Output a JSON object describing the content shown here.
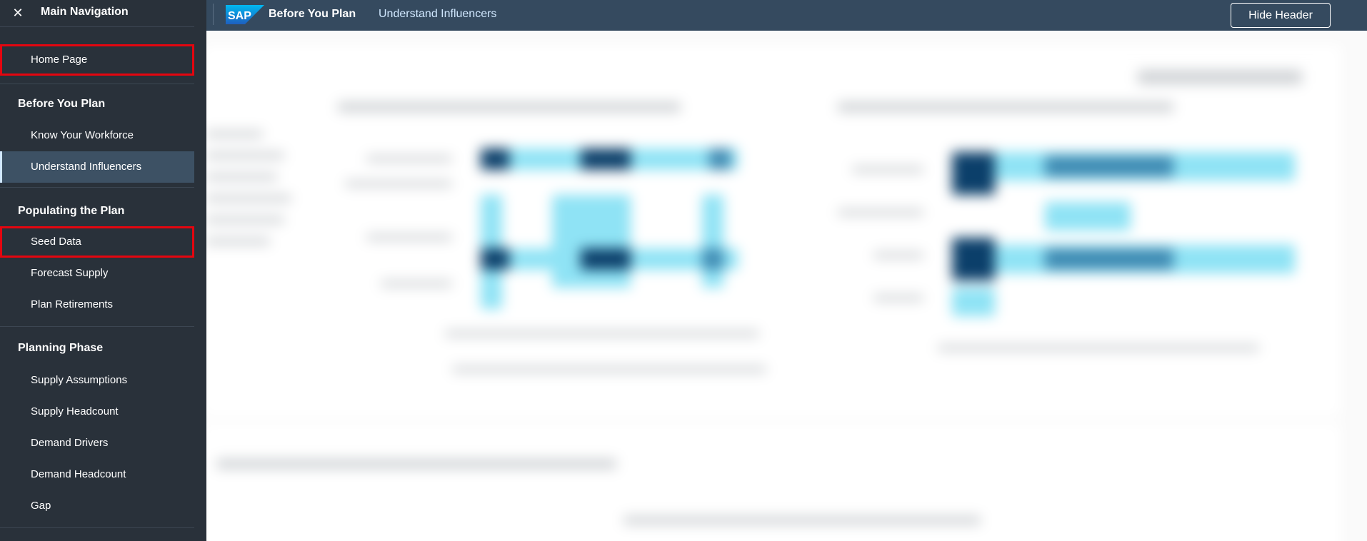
{
  "shell": {
    "app_title": "Before You Plan",
    "breadcrumb": "Understand Influencers",
    "hide_header_label": "Hide Header",
    "logo_text": "SAP"
  },
  "nav": {
    "title": "Main Navigation",
    "close_glyph": "✕",
    "home": "Home Page",
    "groups": [
      {
        "label": "Before You Plan",
        "items": [
          "Know Your Workforce",
          "Understand Influencers"
        ]
      },
      {
        "label": "Populating the Plan",
        "items": [
          "Seed Data",
          "Forecast Supply",
          "Plan Retirements"
        ]
      },
      {
        "label": "Planning Phase",
        "items": [
          "Supply Assumptions",
          "Supply Headcount",
          "Demand Drivers",
          "Demand Headcount",
          "Gap"
        ]
      }
    ],
    "selected_item": "Understand Influencers",
    "highlighted_items": [
      "Home Page",
      "Seed Data"
    ]
  },
  "colors": {
    "shell_bg": "#354a5f",
    "nav_bg": "#29313a",
    "selected_bg": "#3d5164",
    "highlight_border": "#e5050f",
    "heat_light": "#8fe3f5",
    "heat_dark": "#0b3f6a"
  }
}
